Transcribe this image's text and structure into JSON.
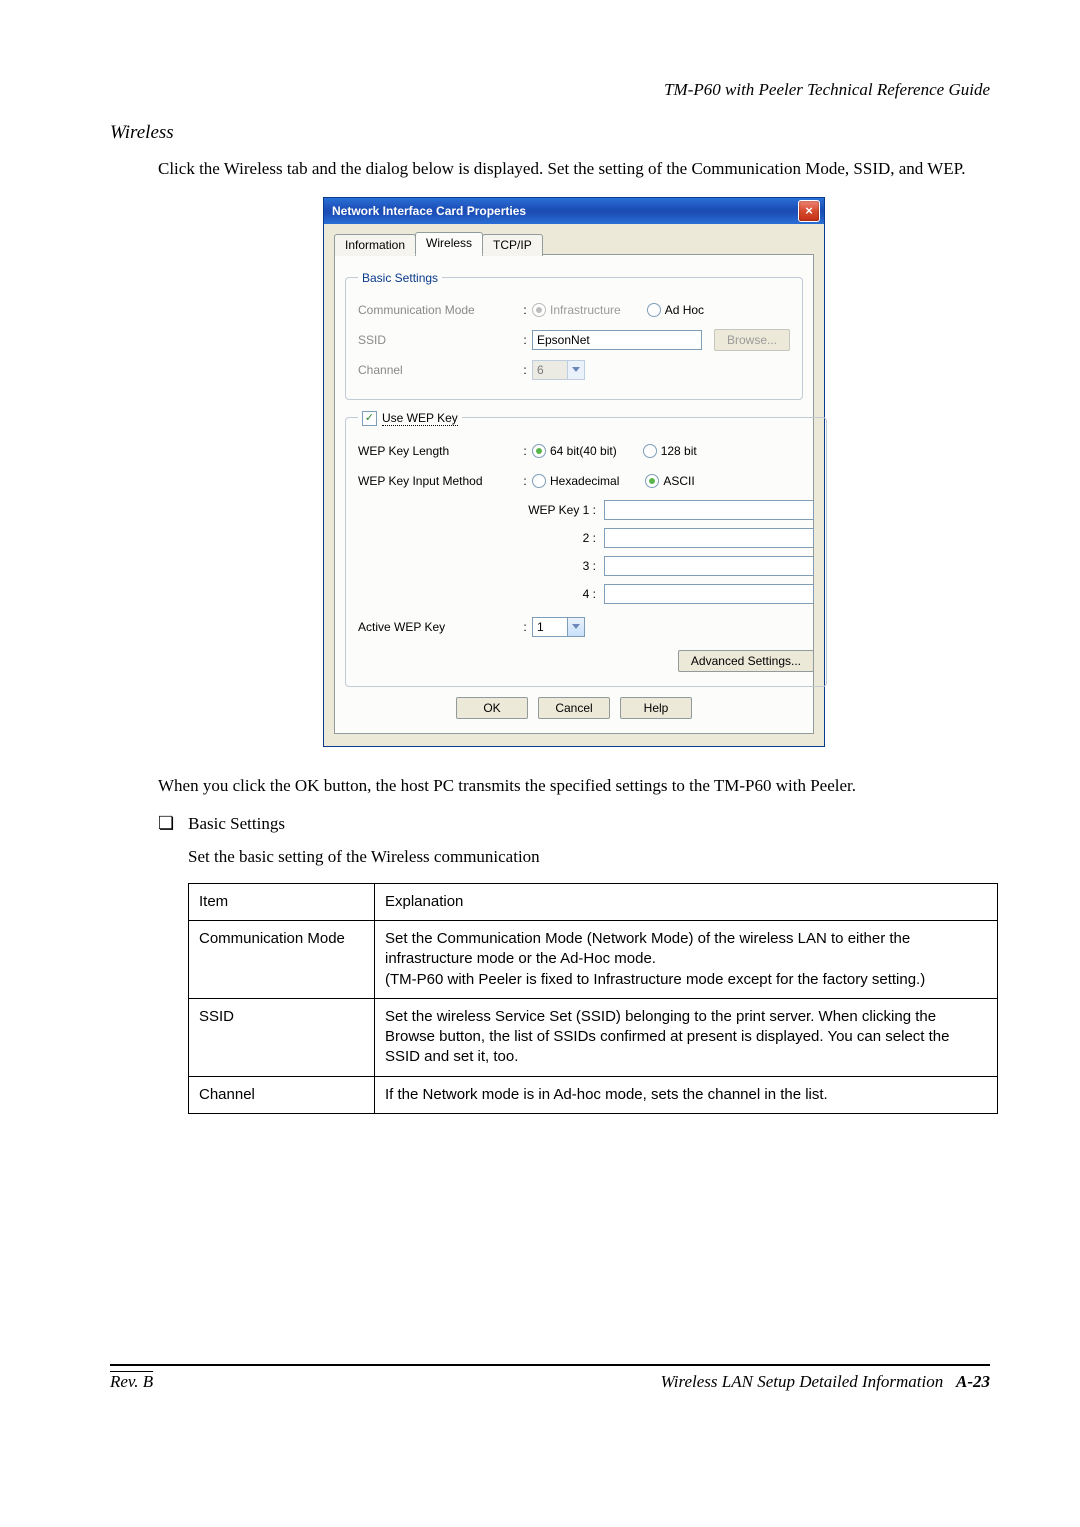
{
  "doc": {
    "guide_title": "TM-P60 with Peeler Technical Reference Guide",
    "section": "Wireless",
    "intro": "Click the Wireless tab and the dialog below is displayed.  Set the setting of the Communication Mode, SSID, and WEP.",
    "after_dialog": "When you click the OK button, the host PC transmits the specified settings to the TM-P60 with Peeler.",
    "bullet": "Basic Settings",
    "subtext": "Set the basic setting of the Wireless communication",
    "footer_left": "Rev. B",
    "footer_right_label": "Wireless LAN Setup Detailed Information",
    "footer_right_page": "A-23"
  },
  "dialog": {
    "title": "Network Interface Card Properties",
    "tabs": {
      "info": "Information",
      "wireless": "Wireless",
      "tcpip": "TCP/IP"
    },
    "basic": {
      "legend": "Basic Settings",
      "comm_label": "Communication Mode",
      "comm_infra": "Infrastructure",
      "comm_adhoc": "Ad Hoc",
      "ssid_label": "SSID",
      "ssid_value": "EpsonNet",
      "browse": "Browse...",
      "channel_label": "Channel",
      "channel_value": "6"
    },
    "wep": {
      "legend": "Use WEP Key",
      "len_label": "WEP Key Length",
      "len_64": "64 bit(40 bit)",
      "len_128": "128 bit",
      "input_label": "WEP Key Input Method",
      "input_hex": "Hexadecimal",
      "input_ascii": "ASCII",
      "key1_label": "WEP Key 1  :",
      "key2_label": "2  :",
      "key3_label": "3  :",
      "key4_label": "4  :",
      "active_label": "Active WEP Key",
      "active_value": "1",
      "advanced": "Advanced Settings..."
    },
    "buttons": {
      "ok": "OK",
      "cancel": "Cancel",
      "help": "Help"
    }
  },
  "table": {
    "header_item": "Item",
    "header_expl": "Explanation",
    "rows": [
      {
        "item": "Communication Mode",
        "expl": "Set the Communication Mode (Network Mode) of the wireless LAN to either the infrastructure mode or the Ad-Hoc mode.\n(TM-P60 with Peeler is fixed to Infrastructure mode except for the factory setting.)"
      },
      {
        "item": "SSID",
        "expl": "Set the wireless Service Set (SSID) belonging to the print server. When clicking the Browse button, the list of SSIDs confirmed at present is displayed. You can select the SSID and set it, too."
      },
      {
        "item": "Channel",
        "expl": "If the Network mode is in Ad-hoc mode, sets the channel in the list."
      }
    ]
  }
}
